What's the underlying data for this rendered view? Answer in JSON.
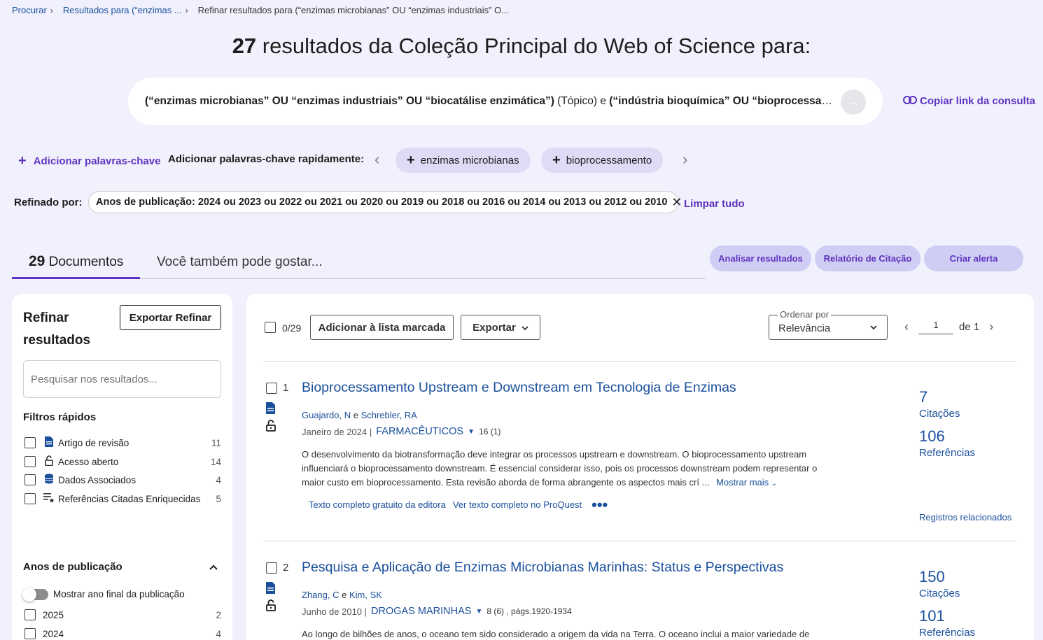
{
  "breadcrumb": {
    "items": [
      "Procurar",
      "Resultados para (“enzimas ...",
      "Refinar resultados para (“enzimas microbianas” OU “enzimas industriais” O..."
    ]
  },
  "heading": {
    "count": "27",
    "text": "resultados da Coleção Principal do Web of Science para:"
  },
  "query": {
    "part1": "(“enzimas microbianas” OU “enzimas industriais” OU “biocatálise enzimática”)",
    "mid": " (Tópico) e ",
    "part2": "(“indústria bioquímica” OU “bioprocessamento...",
    "copy_link": "Copiar link da consulta"
  },
  "keywords": {
    "add": "Adicionar palavras-chave",
    "quick_label": "Adicionar palavras-chave rapidamente:",
    "chips": [
      "enzimas microbianas",
      "bioprocessamento"
    ]
  },
  "refined": {
    "label": "Refinado por:",
    "chip": "Anos de publicação: 2024 ou 2023 ou 2022 ou 2021 ou 2020 ou 2019 ou 2018 ou 2016 ou 2014 ou 2013 ou 2012 ou 2010",
    "clear_all": "Limpar tudo"
  },
  "tabs": {
    "documents_count": "29",
    "documents_label": "Documentos",
    "also_like": "Você também pode gostar..."
  },
  "actions": {
    "analyze": "Analisar resultados",
    "citation_report": "Relatório de Citação",
    "create_alert": "Criar alerta"
  },
  "sidebar": {
    "title_line1": "Refinar",
    "title_line2": "resultados",
    "export_refine": "Exportar Refinar",
    "search_placeholder": "Pesquisar nos resultados...",
    "quick_filters_title": "Filtros rápidos",
    "quick_filters": [
      {
        "label": "Artigo de revisão",
        "count": "11",
        "icon": "document-icon"
      },
      {
        "label": "Acesso aberto",
        "count": "14",
        "icon": "open-lock-icon"
      },
      {
        "label": "Dados Associados",
        "count": "4",
        "icon": "database-icon"
      },
      {
        "label": "Referências Citadas Enriquecidas",
        "count": "5",
        "icon": "enriched-list-icon"
      }
    ],
    "years_title": "Anos de publicação",
    "show_final_year": "Mostrar ano final da publicação",
    "years": [
      {
        "label": "2025",
        "count": "2"
      },
      {
        "label": "2024",
        "count": "4"
      }
    ]
  },
  "toolbar": {
    "selected": "0/29",
    "add_marked": "Adicionar à lista marcada",
    "export": "Exportar",
    "sort_label": "Ordenar por",
    "sort_value": "Relevância",
    "page": "1",
    "page_of": "de 1"
  },
  "records": [
    {
      "num": "1",
      "title": "Bioprocessamento Upstream e Downstream em Tecnologia de Enzimas",
      "author1": "Guajardo, N",
      "conj": "e",
      "author2": "Schrebler, RA",
      "date": "Janeiro de 2024 |",
      "journal": "FARMACÊUTICOS",
      "volume": "16 (1)",
      "abstract": "O desenvolvimento da biotransformação deve integrar os processos upstream e downstream. O bioprocessamento upstream influenciará o bioprocessamento downstream. É essencial considerar isso, pois os processos downstream podem representar o maior custo em bioprocessamento. Esta revisão aborda de forma abrangente os aspectos mais crí ...",
      "show_more": "Mostrar mais",
      "link1": "Texto completo gratuito da editora",
      "link2": "Ver texto completo no ProQuest",
      "citations": "7",
      "citations_label": "Citações",
      "references": "106",
      "references_label": "Referências",
      "related": "Registros relacionados"
    },
    {
      "num": "2",
      "title": "Pesquisa e Aplicação de Enzimas Microbianas Marinhas: Status e Perspectivas",
      "author1": "Zhang, C",
      "conj": "e",
      "author2": "Kim, SK",
      "date": "Junho de 2010 |",
      "journal": "DROGAS MARINHAS",
      "volume": "8 (6) , págs.1920-1934",
      "abstract": "Ao longo de bilhões de anos, o oceano tem sido considerado a origem da vida na Terra. O oceano inclui a maior variedade de",
      "citations": "150",
      "citations_label": "Citações",
      "references": "101",
      "references_label": "Referências"
    }
  ],
  "colors": {
    "accent": "#5e33bf",
    "link": "#1a4f9c",
    "background": "#f1f1fd",
    "pill": "#cfcdf4"
  }
}
